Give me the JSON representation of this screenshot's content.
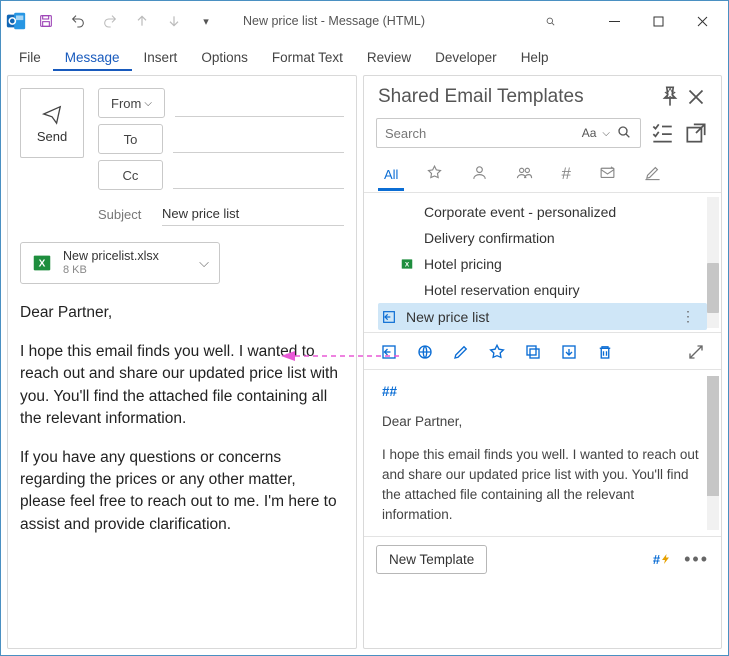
{
  "window": {
    "title": "New price list  -  Message (HTML)"
  },
  "menubar": [
    "File",
    "Message",
    "Insert",
    "Options",
    "Format Text",
    "Review",
    "Developer",
    "Help"
  ],
  "menubar_active_index": 1,
  "compose": {
    "send_label": "Send",
    "from_label": "From",
    "to_label": "To",
    "cc_label": "Cc",
    "subject_label": "Subject",
    "subject_value": "New price list",
    "attachment": {
      "name": "New pricelist.xlsx",
      "size": "8 KB"
    },
    "greeting": "Dear Partner,",
    "para1": "I hope this email finds you well. I wanted to reach out and share our updated price list with you. You'll find the attached file containing all the relevant information.",
    "para2": "If you have any questions or concerns regarding the prices or any other matter, please feel free to reach out to me. I'm here to assist and provide clarification."
  },
  "panel": {
    "title": "Shared Email Templates",
    "search_placeholder": "Search",
    "search_size_label": "Aa",
    "tab_all_label": "All",
    "templates": [
      {
        "label": "Corporate event - personalized",
        "selected": false,
        "icon": null
      },
      {
        "label": "Delivery confirmation",
        "selected": false,
        "icon": null
      },
      {
        "label": "Hotel pricing",
        "selected": false,
        "icon": "excel"
      },
      {
        "label": "Hotel reservation enquiry",
        "selected": false,
        "icon": null
      },
      {
        "label": "New price list",
        "selected": true,
        "icon": "insert"
      }
    ],
    "preview_tag": "##",
    "preview_greeting": "Dear Partner,",
    "preview_body": "I hope this email finds you well. I wanted to reach out and share our updated price list with you. You'll find the attached file containing all the relevant information.",
    "new_template_label": "New Template",
    "hash_bolt": "#"
  }
}
